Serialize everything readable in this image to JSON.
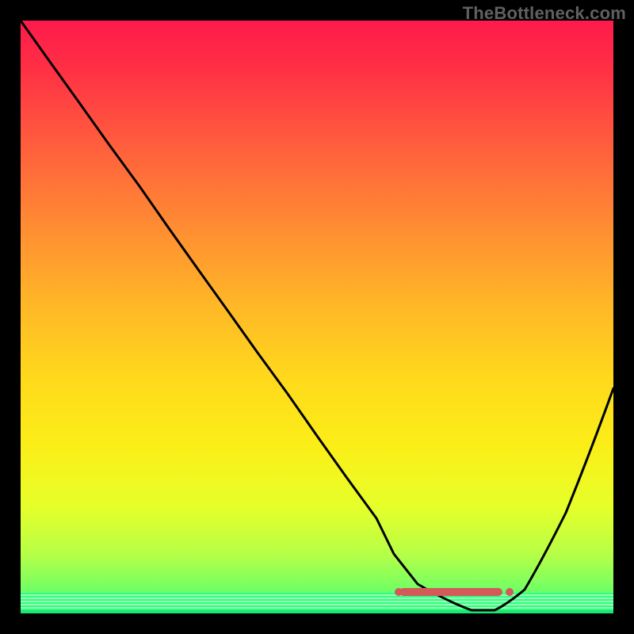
{
  "watermark": "TheBottleneck.com",
  "chart_data": {
    "type": "line",
    "title": "",
    "xlabel": "",
    "ylabel": "",
    "xlim": [
      0,
      100
    ],
    "ylim": [
      0,
      100
    ],
    "grid": false,
    "series": [
      {
        "name": "curve",
        "x": [
          0,
          5,
          10,
          15,
          20,
          25,
          30,
          35,
          40,
          45,
          50,
          55,
          60,
          63,
          67,
          72,
          76,
          80,
          82,
          85,
          88,
          92,
          96,
          100
        ],
        "y": [
          100,
          93,
          86,
          79,
          72,
          65,
          58,
          51,
          44,
          37,
          30,
          23,
          16,
          10,
          5,
          2,
          0.5,
          0.5,
          1.5,
          4,
          9,
          17,
          27,
          38
        ]
      }
    ],
    "highlight_range_x": [
      63,
      82
    ],
    "background_gradient": {
      "top": "#ff1a4b",
      "mid": "#ffd81c",
      "bottom": "#33ff80"
    }
  }
}
